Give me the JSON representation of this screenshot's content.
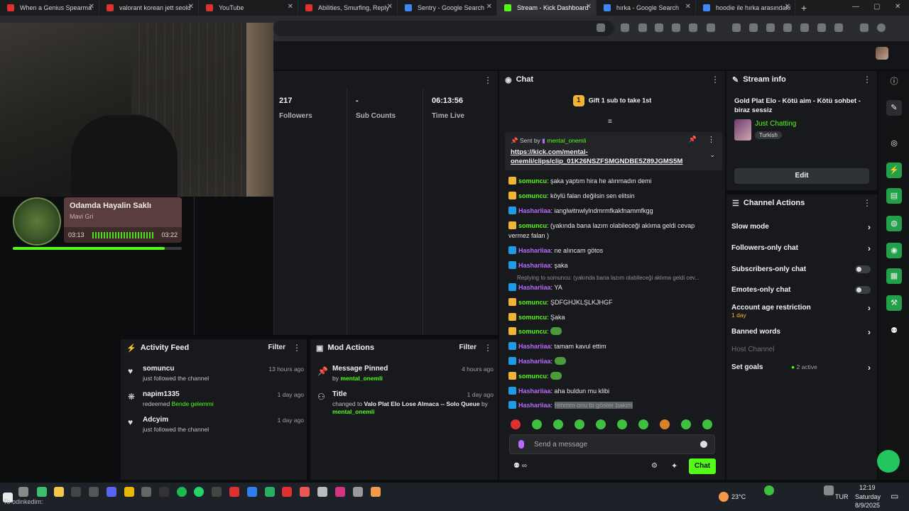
{
  "browser": {
    "tabs": [
      {
        "label": "When a Genius Spearma",
        "color": "#e03131"
      },
      {
        "label": "valorant korean jett seold",
        "color": "#e03131"
      },
      {
        "label": "YouTube",
        "color": "#e03131"
      },
      {
        "label": "Abilities, Smurfing, Reply",
        "color": "#e03131"
      },
      {
        "label": "Sentry - Google Search",
        "color": "#4285f4"
      },
      {
        "label": "Stream - Kick Dashboard",
        "color": "#53fc18"
      },
      {
        "label": "hırka - Google Search",
        "color": "#4285f4"
      },
      {
        "label": "hoodie ile hırka arasındaki",
        "color": "#4285f4"
      }
    ]
  },
  "now_playing": {
    "title": "Odamda Hayalin Saklı",
    "artist": "Mavi Gri",
    "elapsed": "03:13",
    "total": "03:22",
    "progress": 0.9
  },
  "stats": [
    {
      "value": "217",
      "label": "Followers"
    },
    {
      "value": "-",
      "label": "Sub Counts"
    },
    {
      "value": "06:13:56",
      "label": "Time Live"
    }
  ],
  "activity": {
    "title": "Activity Feed",
    "filter": "Filter",
    "items": [
      {
        "name": "somuncu",
        "sub": "just followed the channel",
        "sub_green": "",
        "time": "13 hours ago"
      },
      {
        "name": "napim1335",
        "sub": "redeemed",
        "sub_green": "Bende gelemmi",
        "time": "1 day ago"
      },
      {
        "name": "Adcyim",
        "sub": "just followed the channel",
        "sub_green": "",
        "time": "1 day ago"
      }
    ]
  },
  "mod": {
    "title": "Mod Actions",
    "filter": "Filter",
    "items": [
      {
        "name": "Message Pinned",
        "pre": "by",
        "green": "mental_onemli",
        "time": "4 hours ago"
      },
      {
        "name": "Title",
        "pre": "changed to",
        "bold": "Valo Plat Elo Lose Almaca -- Solo Queue",
        "mid": "by",
        "green": "mental_onemli",
        "time": "1 day ago"
      }
    ]
  },
  "chat": {
    "title": "Chat",
    "gift": "Gift 1 sub to take 1st",
    "gift_badge": "1",
    "pinned_by_label": "Sent by",
    "pinned_by_user": "mental_onemli",
    "pinned_link": "https://kick.com/mental-onemli/clips/clip_01K26NSZFSMGNDBE5Z89JGMS5M",
    "messages": [
      {
        "badge": "crown",
        "user": "somuncu",
        "userclass": "u1",
        "text": "şaka yaptım hira he alınmadın demi"
      },
      {
        "badge": "crown",
        "user": "somuncu",
        "userclass": "u1",
        "text": "köylü falan değilsin sen elitsin"
      },
      {
        "badge": "arrow",
        "user": "Hashariiaa",
        "userclass": "u2",
        "text": "ianglwitnwlylndmrmfkakfnammfkgg"
      },
      {
        "badge": "crown",
        "user": "somuncu",
        "userclass": "u1",
        "text": "(yakında bana lazım olabileceği aklıma geldi cevap vermez falan )"
      },
      {
        "badge": "arrow",
        "user": "Hashariiaa",
        "userclass": "u2",
        "text": "ne alıncam götos"
      },
      {
        "badge": "arrow",
        "user": "Hashariiaa",
        "userclass": "u2",
        "text": "şaka"
      },
      {
        "badge": "arrow",
        "user": "Hashariiaa",
        "userclass": "u2",
        "text": "YA"
      },
      {
        "badge": "crown",
        "user": "somuncu",
        "userclass": "u1",
        "text": "ŞDFGHJKLŞLKJHGF"
      },
      {
        "badge": "crown",
        "user": "somuncu",
        "userclass": "u1",
        "text": "Şaka"
      },
      {
        "badge": "crown",
        "user": "somuncu",
        "userclass": "u1",
        "text": ""
      },
      {
        "badge": "arrow",
        "user": "Hashariiaa",
        "userclass": "u2",
        "text": "tamam kavul ettim"
      },
      {
        "badge": "arrow",
        "user": "Hashariiaa",
        "userclass": "u2",
        "text": ""
      },
      {
        "badge": "crown",
        "user": "somuncu",
        "userclass": "u1",
        "text": ""
      },
      {
        "badge": "arrow",
        "user": "Hashariiaa",
        "userclass": "u2",
        "text": "aha buldun mu klibi"
      },
      {
        "badge": "arrow",
        "user": "Hashariiaa",
        "userclass": "u2",
        "text": "Hmmm onu bi göster bakim",
        "highlight": true
      }
    ],
    "reply_text": "Replying to somuncu: (yakında bana lazım olabileceği aklıma geldi cev...",
    "input_placeholder": "Send a message",
    "send_label": "Chat",
    "foot": "∞"
  },
  "stream_info": {
    "title": "Stream info",
    "stream_title": "Gold Plat Elo - Kötü aim - Kötü sohbet - biraz sessiz",
    "category": "Just Chatting",
    "language": "Turkish",
    "edit": "Edit"
  },
  "channel_actions": {
    "title": "Channel Actions",
    "items": [
      {
        "label": "Slow mode",
        "control": "chevron"
      },
      {
        "label": "Followers-only chat",
        "control": "chevron"
      },
      {
        "label": "Subscribers-only chat",
        "control": "toggle"
      },
      {
        "label": "Emotes-only chat",
        "control": "toggle"
      },
      {
        "label": "Account age restriction",
        "sub": "1 day",
        "control": "chevron"
      },
      {
        "label": "Banned words",
        "control": "chevron"
      },
      {
        "label": "Host Channel",
        "control": "none",
        "dim": true
      },
      {
        "label": "Set goals",
        "status": "2 active",
        "control": "chevron"
      }
    ]
  },
  "taskbar": {
    "temperature": "23°C",
    "lang": "TUR",
    "time": "12:19",
    "day": "Saturday",
    "date": "8/9/2025",
    "caption": "To odinkedim:"
  },
  "colors": {
    "accent": "#53fc18",
    "gold": "#f2b433",
    "purple": "#b66bff"
  }
}
